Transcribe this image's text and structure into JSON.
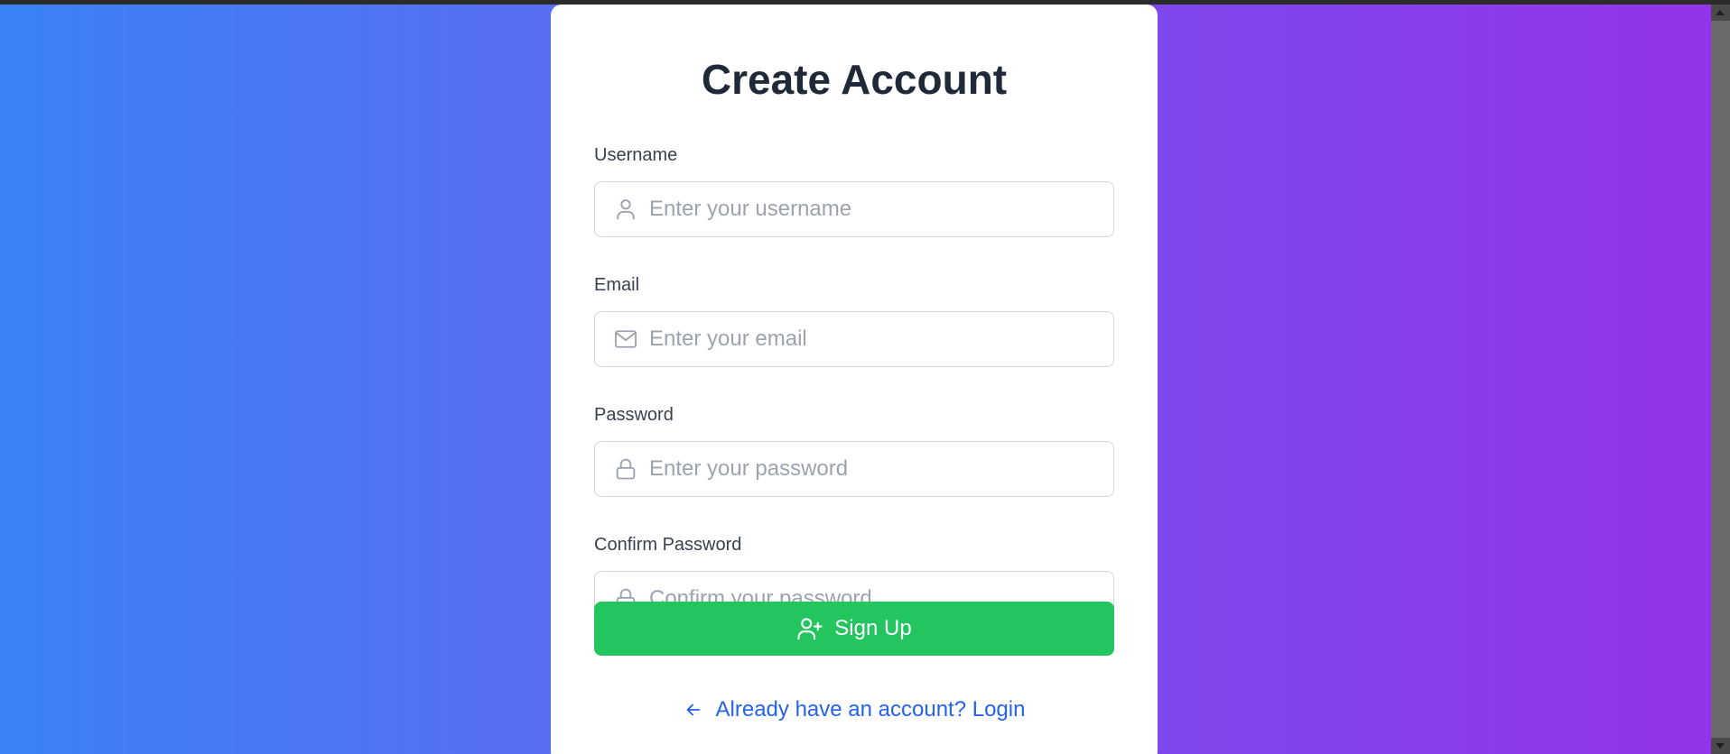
{
  "form": {
    "title": "Create Account",
    "fields": [
      {
        "label": "Username",
        "placeholder": "Enter your username",
        "icon": "user-icon"
      },
      {
        "label": "Email",
        "placeholder": "Enter your email",
        "icon": "mail-icon"
      },
      {
        "label": "Password",
        "placeholder": "Enter your password",
        "icon": "lock-icon"
      },
      {
        "label": "Confirm Password",
        "placeholder": "Confirm your password",
        "icon": "lock-icon"
      }
    ],
    "submit_label": "Sign Up",
    "submit_icon": "user-plus-icon",
    "login_link": "Already have an account? Login",
    "login_icon": "arrow-left-icon"
  },
  "colors": {
    "gradient_start": "#3b82f6",
    "gradient_end": "#9333ea",
    "button": "#22c55e",
    "link": "#2563eb",
    "title": "#1f2937"
  }
}
